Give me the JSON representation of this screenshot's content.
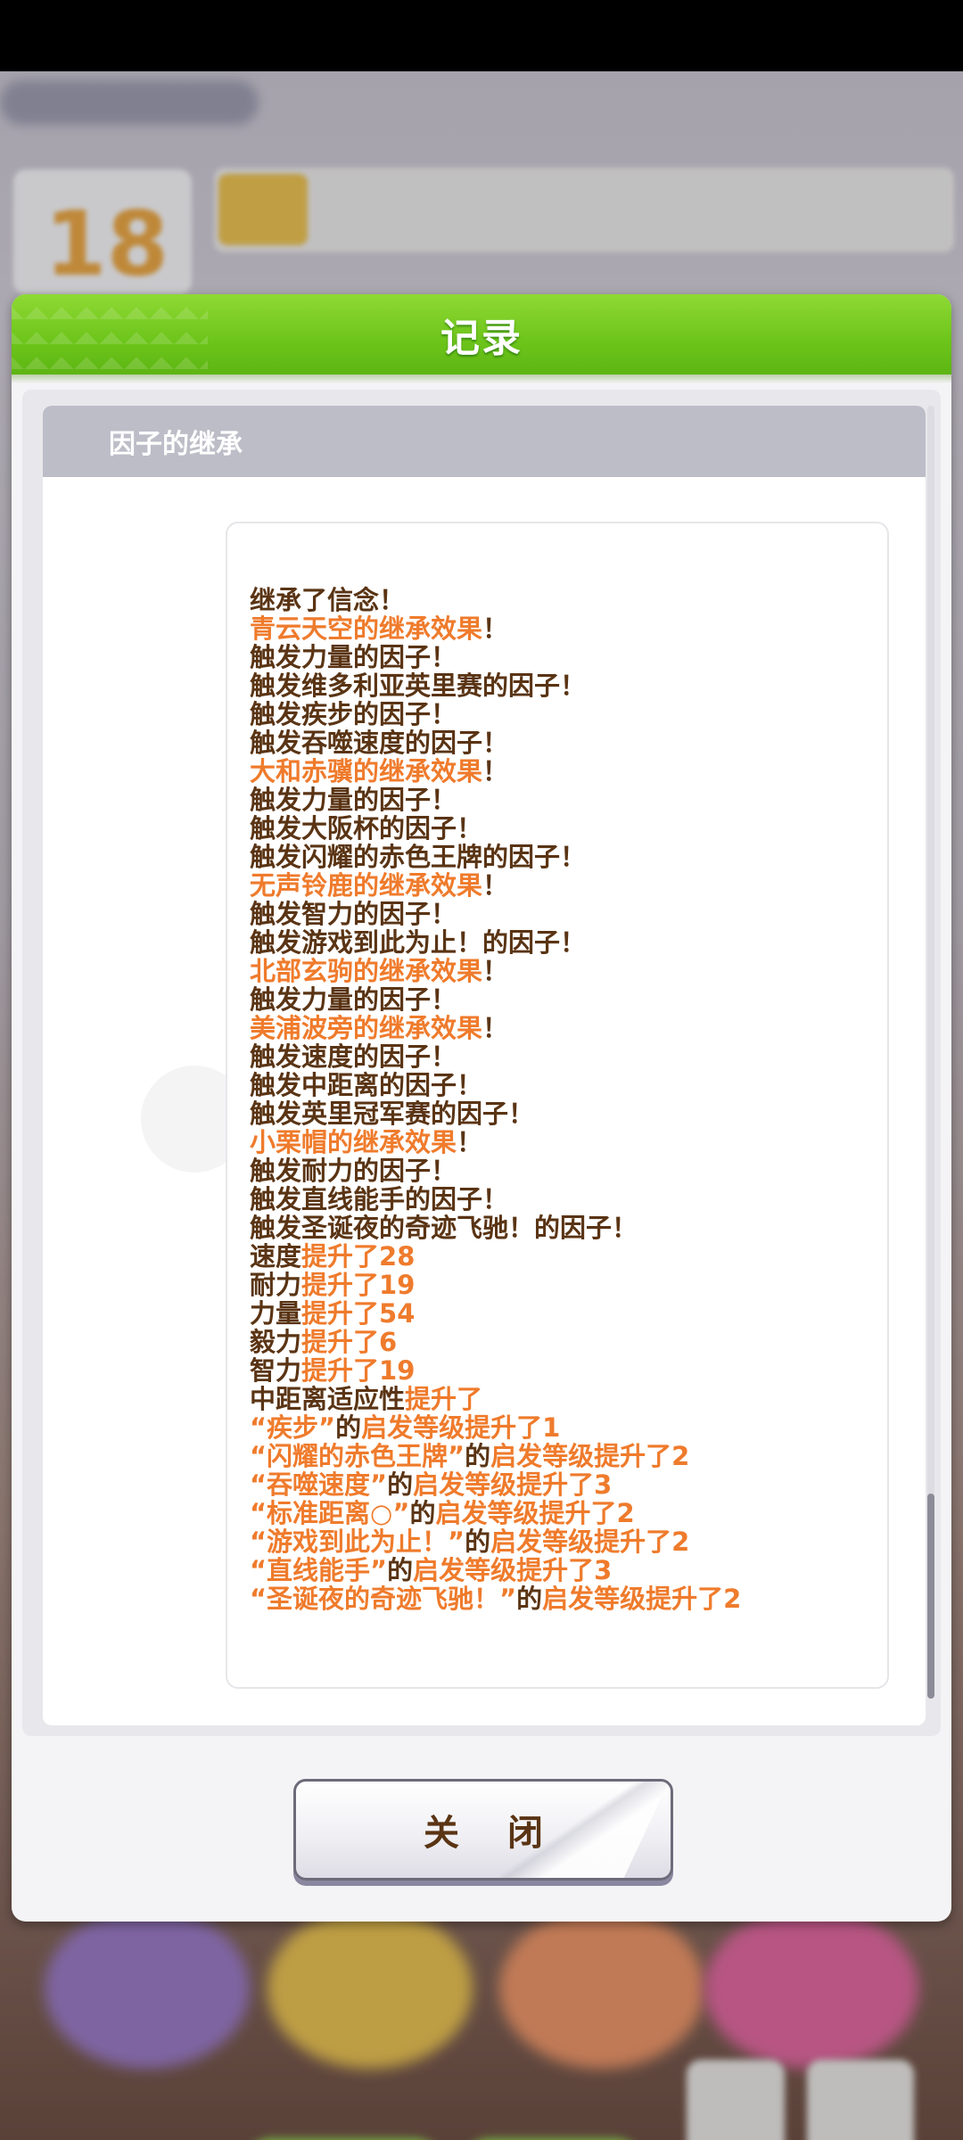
{
  "background": {
    "calendar_day": "18"
  },
  "dialog": {
    "title": "记录",
    "section_title": "因子的继承",
    "close_label": "关 闭"
  },
  "log": [
    [
      {
        "t": "继承了信念！",
        "c": "n"
      }
    ],
    [
      {
        "t": "青云天空的继承效果",
        "c": "o"
      },
      {
        "t": "！",
        "c": "n"
      }
    ],
    [
      {
        "t": "触发力量的因子！",
        "c": "n"
      }
    ],
    [
      {
        "t": "触发维多利亚英里赛的因子！",
        "c": "n"
      }
    ],
    [
      {
        "t": "触发疾步的因子！",
        "c": "n"
      }
    ],
    [
      {
        "t": "触发吞噬速度的因子！",
        "c": "n"
      }
    ],
    [
      {
        "t": "大和赤骥的继承效果",
        "c": "o"
      },
      {
        "t": "！",
        "c": "n"
      }
    ],
    [
      {
        "t": "触发力量的因子！",
        "c": "n"
      }
    ],
    [
      {
        "t": "触发大阪杯的因子！",
        "c": "n"
      }
    ],
    [
      {
        "t": "触发闪耀的赤色王牌的因子！",
        "c": "n"
      }
    ],
    [
      {
        "t": "无声铃鹿的继承效果",
        "c": "o"
      },
      {
        "t": "！",
        "c": "n"
      }
    ],
    [
      {
        "t": "触发智力的因子！",
        "c": "n"
      }
    ],
    [
      {
        "t": "触发游戏到此为止！的因子！",
        "c": "n"
      }
    ],
    [
      {
        "t": "北部玄驹的继承效果",
        "c": "o"
      },
      {
        "t": "！",
        "c": "n"
      }
    ],
    [
      {
        "t": "触发力量的因子！",
        "c": "n"
      }
    ],
    [
      {
        "t": "美浦波旁的继承效果",
        "c": "o"
      },
      {
        "t": "！",
        "c": "n"
      }
    ],
    [
      {
        "t": "触发速度的因子！",
        "c": "n"
      }
    ],
    [
      {
        "t": "触发中距离的因子！",
        "c": "n"
      }
    ],
    [
      {
        "t": "触发英里冠军赛的因子！",
        "c": "n"
      }
    ],
    [
      {
        "t": "小栗帽的继承效果",
        "c": "o"
      },
      {
        "t": "！",
        "c": "n"
      }
    ],
    [
      {
        "t": "触发耐力的因子！",
        "c": "n"
      }
    ],
    [
      {
        "t": "触发直线能手的因子！",
        "c": "n"
      }
    ],
    [
      {
        "t": "触发圣诞夜的奇迹飞驰！的因子！",
        "c": "n"
      }
    ],
    [
      {
        "t": "速度",
        "c": "n"
      },
      {
        "t": "提升了28",
        "c": "o"
      }
    ],
    [
      {
        "t": "耐力",
        "c": "n"
      },
      {
        "t": "提升了19",
        "c": "o"
      }
    ],
    [
      {
        "t": "力量",
        "c": "n"
      },
      {
        "t": "提升了54",
        "c": "o"
      }
    ],
    [
      {
        "t": "毅力",
        "c": "n"
      },
      {
        "t": "提升了6",
        "c": "o"
      }
    ],
    [
      {
        "t": "智力",
        "c": "n"
      },
      {
        "t": "提升了19",
        "c": "o"
      }
    ],
    [
      {
        "t": "中距离适应性",
        "c": "n"
      },
      {
        "t": "提升了",
        "c": "o"
      }
    ],
    [
      {
        "t": "“疾步”",
        "c": "o"
      },
      {
        "t": "的",
        "c": "n"
      },
      {
        "t": "启发等级提升了1",
        "c": "o"
      }
    ],
    [
      {
        "t": "“闪耀的赤色王牌”",
        "c": "o"
      },
      {
        "t": "的",
        "c": "n"
      },
      {
        "t": "启发等级提升了2",
        "c": "o"
      }
    ],
    [
      {
        "t": "“吞噬速度”",
        "c": "o"
      },
      {
        "t": "的",
        "c": "n"
      },
      {
        "t": "启发等级提升了3",
        "c": "o"
      }
    ],
    [
      {
        "t": "“标准距离○”",
        "c": "o"
      },
      {
        "t": "的",
        "c": "n"
      },
      {
        "t": "启发等级提升了2",
        "c": "o"
      }
    ],
    [
      {
        "t": "“游戏到此为止！”",
        "c": "o"
      },
      {
        "t": "的",
        "c": "n"
      },
      {
        "t": "启发等级提升了2",
        "c": "o"
      }
    ],
    [
      {
        "t": "“直线能手”",
        "c": "o"
      },
      {
        "t": "的",
        "c": "n"
      },
      {
        "t": "启发等级提升了3",
        "c": "o"
      }
    ],
    [
      {
        "t": "“圣诞夜的奇迹飞驰！”",
        "c": "o"
      },
      {
        "t": "的",
        "c": "n"
      },
      {
        "t": "启发等级提升了2",
        "c": "o"
      }
    ]
  ],
  "colors": {
    "normal_text": "#5a3414",
    "highlight_text": "#ef7b2c",
    "header_green": "#6cc41a",
    "section_head": "#bdbdc8"
  },
  "scroll": {
    "position_fraction": 1.0
  }
}
